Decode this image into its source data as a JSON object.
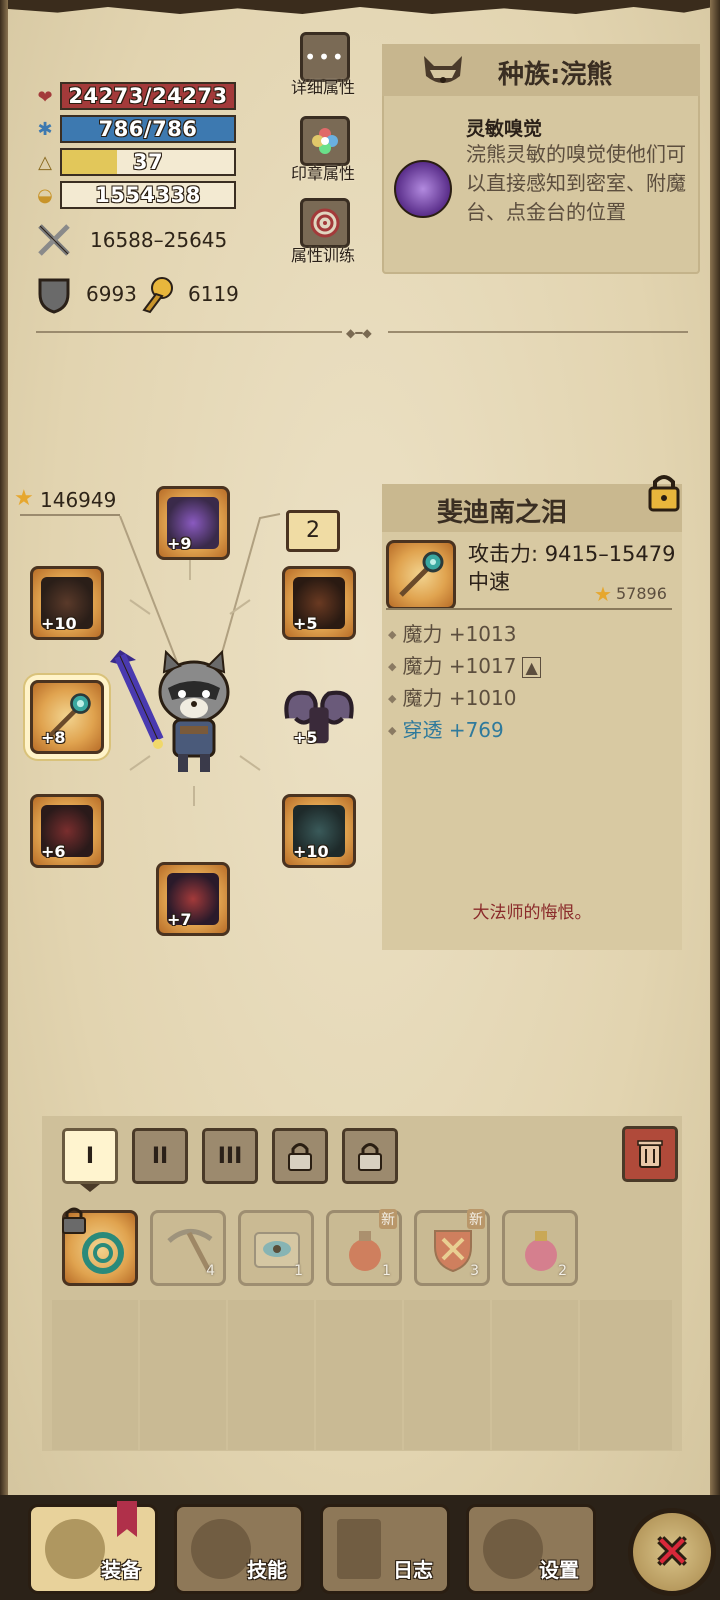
{
  "stats": {
    "hp": "24273/24273",
    "hp_fraction": 1.0,
    "mp": "786/786",
    "mp_fraction": 1.0,
    "level": "37",
    "level_fraction": 0.32,
    "gold": "1554338",
    "attack": "16588–25645",
    "defense": "6993",
    "magic_resist": "6119"
  },
  "side_buttons": {
    "detail_label": "详细属性",
    "seal_label": "印章属性",
    "training_label": "属性训练"
  },
  "race": {
    "title": "种族:浣熊",
    "trait_name": "灵敏嗅觉",
    "trait_desc": "浣熊灵敏的嗅觉使他们可以直接感知到密室、附魔台、点金台的位置"
  },
  "equipment": {
    "total_score": "146949",
    "page_badge": "2",
    "slots": [
      {
        "name": "helmet",
        "plus": "+9"
      },
      {
        "name": "shoulder",
        "plus": "+10"
      },
      {
        "name": "chest-armor",
        "plus": "+5"
      },
      {
        "name": "weapon-staff",
        "plus": "+8"
      },
      {
        "name": "ram-horns",
        "plus": "+5"
      },
      {
        "name": "gauntlet",
        "plus": "+6"
      },
      {
        "name": "leg-armor",
        "plus": "+10"
      },
      {
        "name": "boots",
        "plus": "+7"
      }
    ]
  },
  "item": {
    "name": "斐迪南之泪",
    "attack": "攻击力: 9415–15479",
    "speed": "中速",
    "score": "57896",
    "attributes": [
      "魔力 +1013",
      "魔力 +1017",
      "魔力 +1010"
    ],
    "special_attribute": "穿透 +769",
    "flavor": "大法师的悔恨。"
  },
  "inventory": {
    "tabs": [
      "I",
      "II",
      "III"
    ],
    "items": [
      {
        "name": "locked-rope",
        "count": ""
      },
      {
        "name": "pickaxe",
        "count": "4"
      },
      {
        "name": "eye-scroll",
        "count": "1"
      },
      {
        "name": "red-potion",
        "count": "1",
        "badge": "新"
      },
      {
        "name": "shield-item",
        "count": "3",
        "badge": "新"
      },
      {
        "name": "pink-potion",
        "count": "2"
      }
    ]
  },
  "nav": {
    "equip": "装备",
    "skills": "技能",
    "log": "日志",
    "settings": "设置"
  },
  "colors": {
    "hp": "#a33a3a",
    "mp": "#3d79b0",
    "exp": "#e2c75a",
    "special_attr": "#2f7a9c"
  }
}
